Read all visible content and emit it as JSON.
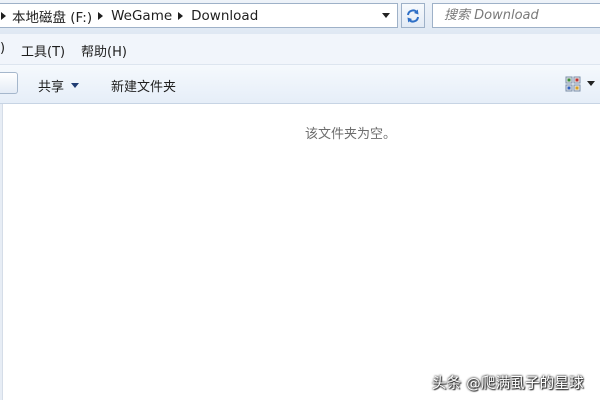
{
  "address_bar": {
    "crumbs": [
      "本地磁盘 (F:)",
      "WeGame",
      "Download"
    ]
  },
  "search": {
    "placeholder": "搜索 Download"
  },
  "menu": {
    "partial_item": ")",
    "tools": "工具(T)",
    "help": "帮助(H)"
  },
  "toolbar": {
    "share": "共享",
    "new_folder": "新建文件夹"
  },
  "content": {
    "empty_message": "该文件夹为空。"
  },
  "watermark": "头条 @爬满虱子的星球",
  "icons": {
    "refresh": "refresh-icon",
    "view": "view-options-icon",
    "breadcrumb_separator": "chevron-right-icon",
    "dropdown": "chevron-down-icon"
  },
  "colors": {
    "chrome_blue": "#dfe8f3",
    "border": "#9eb1c8",
    "refresh_accent": "#2e6fc6"
  }
}
